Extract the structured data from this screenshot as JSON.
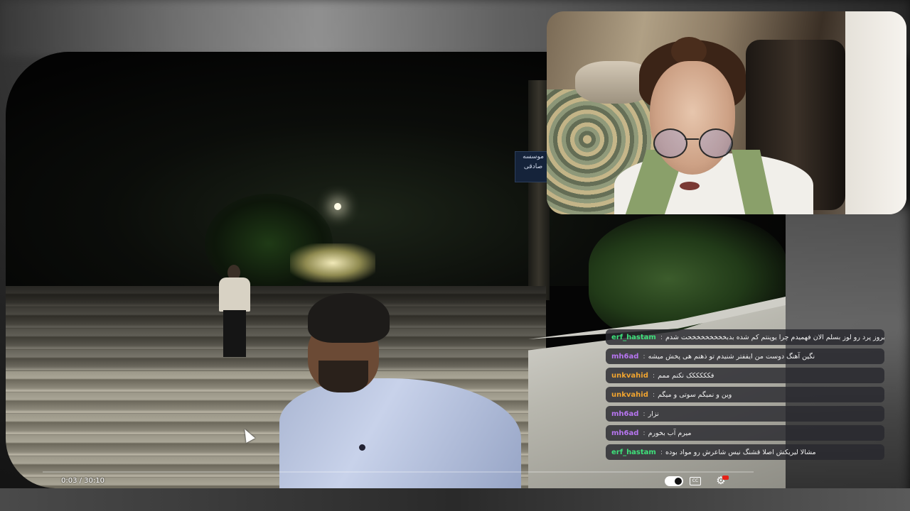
{
  "player": {
    "current_time": "0:03",
    "duration": "30:10",
    "time_display": "0:03 / 30:10",
    "controls": {
      "autoplay_toggle": "autoplay-toggle-icon",
      "captions": "captions-icon",
      "settings": "settings-gear-icon",
      "hd_badge_color": "#e62117"
    }
  },
  "video": {
    "sign_text": "موسسه صادقی"
  },
  "chat": {
    "messages": [
      {
        "user": "erf_hastam",
        "color": "#3ee07a",
        "text": "وای الان یادم اومد دیروز پرد رو لوز بسلم الان فهمیدم چرا یوپنتم کم شده بدبخخخخخخخخحت شدم"
      },
      {
        "user": "mh6ad",
        "color": "#b775f0",
        "text": "نگین آهنگ دوست من ایففتر شنیدم تو ذهنم هی پخش میشه"
      },
      {
        "user": "unkvahid",
        "color": "#f0a430",
        "text": "فکککککک نکنم ممم"
      },
      {
        "user": "unkvahid",
        "color": "#f0a430",
        "text": "وین و نمیگم سوتی و میگم"
      },
      {
        "user": "mh6ad",
        "color": "#b775f0",
        "text": "نزار"
      },
      {
        "user": "mh6ad",
        "color": "#b775f0",
        "text": "میرم آب بخورم"
      },
      {
        "user": "erf_hastam",
        "color": "#3ee07a",
        "text": "مشالا لیریکش اصلا قشنگ نیس شاعرش رو مواد بوده"
      }
    ]
  }
}
